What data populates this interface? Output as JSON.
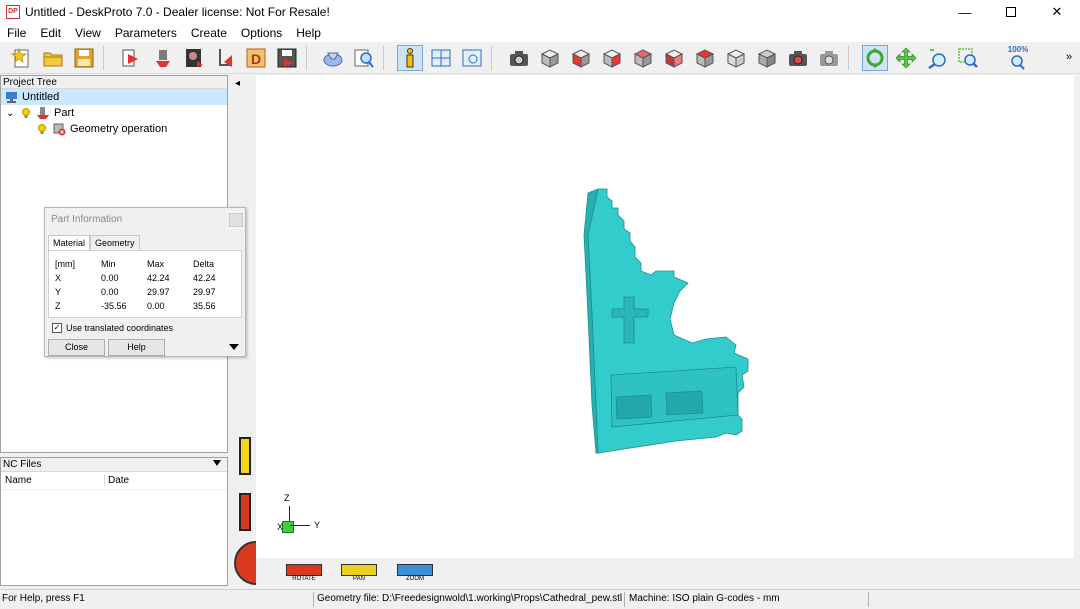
{
  "window": {
    "title": "Untitled - DeskProto 7.0 - Dealer license: Not For Resale!",
    "app_icon_text": "DP",
    "minimize_icon": "minimize-icon",
    "maximize_icon": "maximize-icon",
    "close_icon": "close-icon"
  },
  "menu": {
    "items": [
      "File",
      "Edit",
      "View",
      "Parameters",
      "Create",
      "Options",
      "Help"
    ]
  },
  "toolbar": {
    "zoom_100_label": "100%",
    "overflow": "»"
  },
  "project_tree": {
    "header": "Project Tree",
    "items": [
      {
        "label": "Untitled",
        "icon": "project-icon",
        "selected": true
      },
      {
        "label": "Part",
        "icon": "part-icon",
        "selected": false
      },
      {
        "label": "Geometry operation",
        "icon": "geometry-operation-icon",
        "selected": false
      }
    ],
    "expand_glyph": "⌄"
  },
  "nc_files": {
    "header": "NC Files",
    "columns": [
      "Name",
      "Date"
    ]
  },
  "part_info": {
    "title": "Part Information",
    "tabs": [
      "Material",
      "Geometry"
    ],
    "headers": [
      "[mm]",
      "Min",
      "Max",
      "Delta"
    ],
    "rows": [
      [
        "X",
        "0.00",
        "42.24",
        "42.24"
      ],
      [
        "Y",
        "0.00",
        "29.97",
        "29.97"
      ],
      [
        "Z",
        "-35.56",
        "0.00",
        "35.56"
      ]
    ],
    "checkbox_label": "Use translated coordinates",
    "checkbox_checked": true,
    "close_label": "Close",
    "help_label": "Help"
  },
  "viewport": {
    "axes": {
      "z": "Z",
      "x": "X",
      "y": "Y"
    },
    "model_color": "#33cccc",
    "mode_buttons": [
      {
        "label": "ROTATE",
        "color": "#d93a1e"
      },
      {
        "label": "PAN",
        "color": "#e8d21c"
      },
      {
        "label": "ZOOM",
        "color": "#3a8fd9"
      }
    ],
    "collapse_glyph": "◂"
  },
  "status": {
    "help": "For Help, press F1",
    "geometry_file": "Geometry file: D:\\Freedesignwold\\1.working\\Props\\Cathedral_pew.stl",
    "machine": "Machine: ISO plain G-codes - mm"
  }
}
